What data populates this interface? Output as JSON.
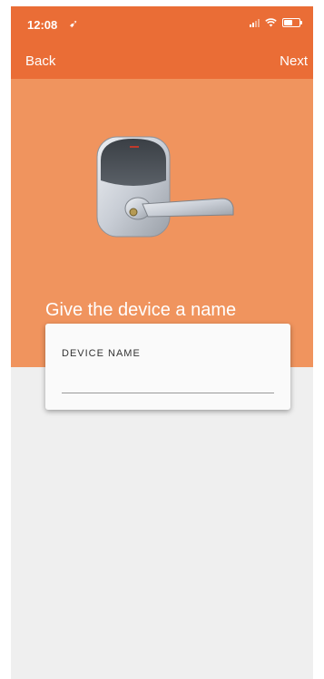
{
  "status_bar": {
    "time": "12:08",
    "location_icon": "location-arrow-icon",
    "signal_icon": "cellular-signal-icon",
    "wifi_icon": "wifi-icon",
    "battery_icon": "battery-icon"
  },
  "nav": {
    "back_label": "Back",
    "next_label": "Next"
  },
  "hero": {
    "image": "door-lock-lever-image",
    "prompt": "Give the device a name"
  },
  "form": {
    "device_name_label": "Device Name",
    "device_name_value": ""
  },
  "colors": {
    "header": "#ea6d36",
    "hero": "#f0945e",
    "background": "#efefef"
  }
}
